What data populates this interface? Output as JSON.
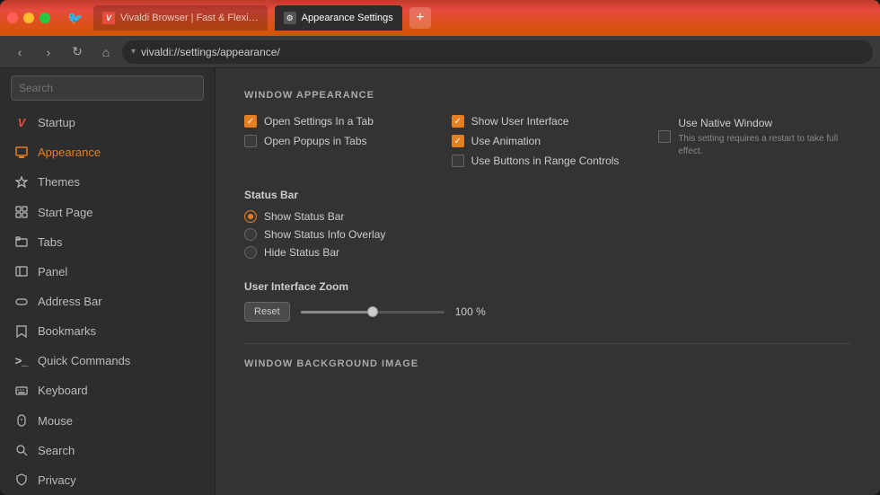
{
  "browser": {
    "traffic_lights": [
      "red",
      "yellow",
      "green"
    ],
    "tabs": [
      {
        "id": "tab-1",
        "label": "Vivaldi Browser | Fast & Flexi…",
        "active": false,
        "favicon": "V"
      },
      {
        "id": "tab-2",
        "label": "Appearance Settings",
        "active": true,
        "favicon": "⚙"
      }
    ],
    "new_tab_label": "+",
    "address_bar": {
      "url": "vivaldi://settings/appearance/",
      "dropdown_char": "▾"
    },
    "nav_buttons": {
      "back": "‹",
      "forward": "›",
      "reload": "↻",
      "home": "⌂"
    }
  },
  "sidebar": {
    "search_placeholder": "Search",
    "items": [
      {
        "id": "startup",
        "label": "Startup",
        "icon": "V"
      },
      {
        "id": "appearance",
        "label": "Appearance",
        "icon": "☐",
        "active": true
      },
      {
        "id": "themes",
        "label": "Themes",
        "icon": "🎨"
      },
      {
        "id": "start-page",
        "label": "Start Page",
        "icon": "⊞"
      },
      {
        "id": "tabs",
        "label": "Tabs",
        "icon": "≡"
      },
      {
        "id": "panel",
        "label": "Panel",
        "icon": "▭"
      },
      {
        "id": "address-bar",
        "label": "Address Bar",
        "icon": "▭"
      },
      {
        "id": "bookmarks",
        "label": "Bookmarks",
        "icon": "🔖"
      },
      {
        "id": "quick-commands",
        "label": "Quick Commands",
        "icon": ">"
      },
      {
        "id": "keyboard",
        "label": "Keyboard",
        "icon": "⌨"
      },
      {
        "id": "mouse",
        "label": "Mouse",
        "icon": "🖱"
      },
      {
        "id": "search",
        "label": "Search",
        "icon": "🔍"
      },
      {
        "id": "privacy",
        "label": "Privacy",
        "icon": "🔒"
      }
    ]
  },
  "content": {
    "section_window_appearance": "WINDOW APPEARANCE",
    "checkboxes_col1": [
      {
        "id": "open-settings-tab",
        "label": "Open Settings In a Tab",
        "checked": true
      },
      {
        "id": "open-popups-tabs",
        "label": "Open Popups in Tabs",
        "checked": false
      }
    ],
    "checkboxes_col2": [
      {
        "id": "show-user-interface",
        "label": "Show User Interface",
        "checked": true
      },
      {
        "id": "use-animation",
        "label": "Use Animation",
        "checked": true
      },
      {
        "id": "use-buttons-range",
        "label": "Use Buttons in Range Controls",
        "checked": false
      }
    ],
    "checkboxes_col3": [
      {
        "id": "use-native-window",
        "label": "Use Native Window",
        "checked": false,
        "note": "This setting requires a restart to take full effect."
      }
    ],
    "status_bar": {
      "title": "Status Bar",
      "options": [
        {
          "id": "show-status-bar",
          "label": "Show Status Bar",
          "selected": true
        },
        {
          "id": "show-status-overlay",
          "label": "Show Status Info Overlay",
          "selected": false
        },
        {
          "id": "hide-status-bar",
          "label": "Hide Status Bar",
          "selected": false
        }
      ]
    },
    "zoom": {
      "title": "User Interface Zoom",
      "reset_label": "Reset",
      "value": "100 %",
      "slider_percent": 50
    },
    "section_window_background": "WINDOW BACKGROUND IMAGE"
  }
}
